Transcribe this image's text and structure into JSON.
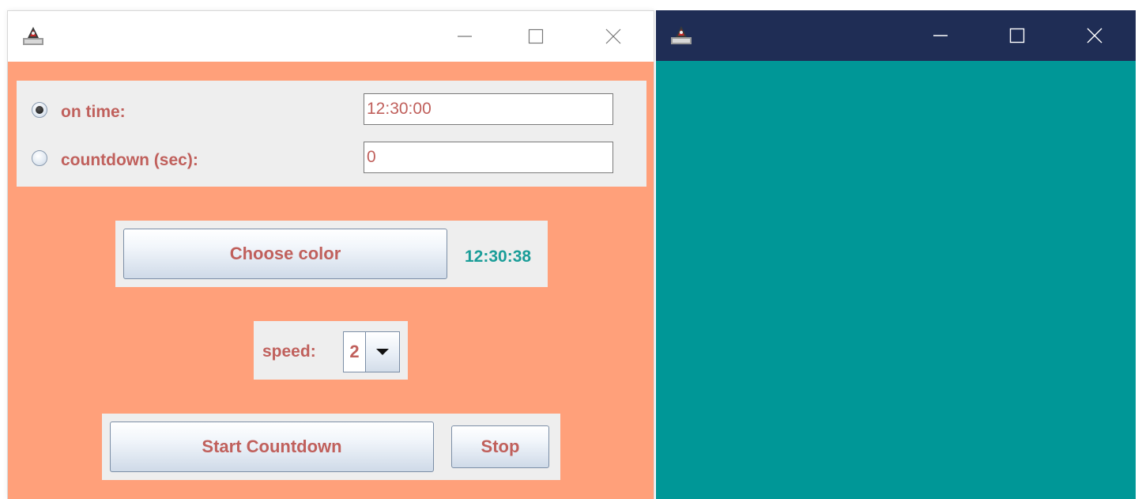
{
  "left_window": {
    "title": "",
    "options": {
      "on_time_label": "on time:",
      "on_time_value": "12:30:00",
      "countdown_label": "countdown (sec):",
      "countdown_value": "0",
      "selected": "on time"
    },
    "choose_color_label": "Choose color",
    "clock_text": "12:30:38",
    "speed_label": "speed:",
    "speed_value": "2",
    "start_label": "Start Countdown",
    "stop_label": "Stop"
  },
  "right_window": {
    "title": ""
  },
  "colors": {
    "left_background": "#ffa07a",
    "panel_background": "#eeeeee",
    "label_text": "#c0605c",
    "clock_text": "#1a9d98",
    "right_background": "#009797",
    "right_titlebar": "#1f2d55"
  },
  "icons": {
    "app": "java-app-icon",
    "minimize": "minimize-icon",
    "maximize": "maximize-icon",
    "close": "close-icon",
    "dropdown": "chevron-down-icon"
  }
}
